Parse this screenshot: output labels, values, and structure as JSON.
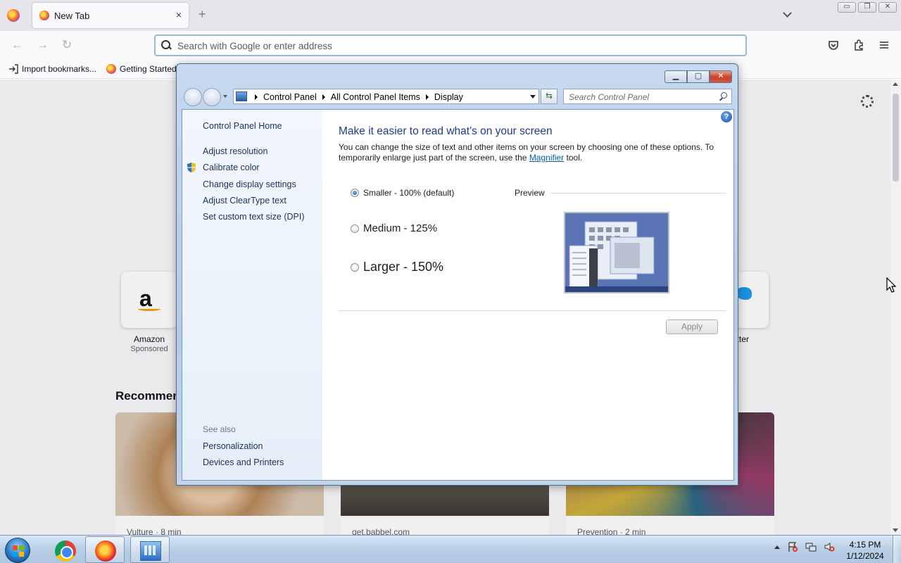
{
  "browser": {
    "tab_title": "New Tab",
    "tab_close": "×",
    "new_tab": "+",
    "url_placeholder": "Search with Google or enter address",
    "bookmarks": [
      {
        "label": "Import bookmarks..."
      },
      {
        "label": "Getting Started"
      }
    ],
    "window_controls": {
      "minimize": "▭",
      "restore": "❐",
      "close": "✕"
    }
  },
  "new_tab_page": {
    "tiles": [
      {
        "label": "Amazon",
        "sub": "Sponsored"
      },
      {
        "label": "itter",
        "sub": ""
      }
    ],
    "recommended_title": "Recommen",
    "cards": [
      {
        "source": "Vulture · 8 min"
      },
      {
        "source": "get.babbel.com"
      },
      {
        "source": "Prevention · 2 min"
      }
    ]
  },
  "control_panel": {
    "breadcrumbs": [
      "Control Panel",
      "All Control Panel Items",
      "Display"
    ],
    "search_placeholder": "Search Control Panel",
    "help": "?",
    "left_links": [
      {
        "label": "Control Panel Home"
      },
      {
        "label": "Adjust resolution"
      },
      {
        "label": "Calibrate color"
      },
      {
        "label": "Change display settings"
      },
      {
        "label": "Adjust ClearType text"
      },
      {
        "label": "Set custom text size (DPI)"
      }
    ],
    "see_also_label": "See also",
    "see_also_links": [
      {
        "label": "Personalization"
      },
      {
        "label": "Devices and Printers"
      }
    ],
    "title": "Make it easier to read what's on your screen",
    "desc_before": "You can change the size of text and other items on your screen by choosing one of these options. To temporarily enlarge just part of the screen, use the ",
    "desc_link": "Magnifier",
    "desc_after": " tool.",
    "options": [
      {
        "label": "Smaller - 100% (default)",
        "checked": true
      },
      {
        "label": "Medium - 125%",
        "checked": false
      },
      {
        "label": "Larger - 150%",
        "checked": false
      }
    ],
    "preview_label": "Preview",
    "apply_label": "Apply",
    "title_buttons": {
      "minimize": "▁",
      "maximize": "▢",
      "close": "✕"
    }
  },
  "taskbar": {
    "apps": [
      "start",
      "chrome",
      "firefox",
      "control-panel"
    ],
    "time": "4:15 PM",
    "date": "1/12/2024"
  },
  "colors": {
    "accent_title": "#1e3a8a",
    "link": "#0b5cab",
    "taskbar": "#b9cfe6"
  }
}
